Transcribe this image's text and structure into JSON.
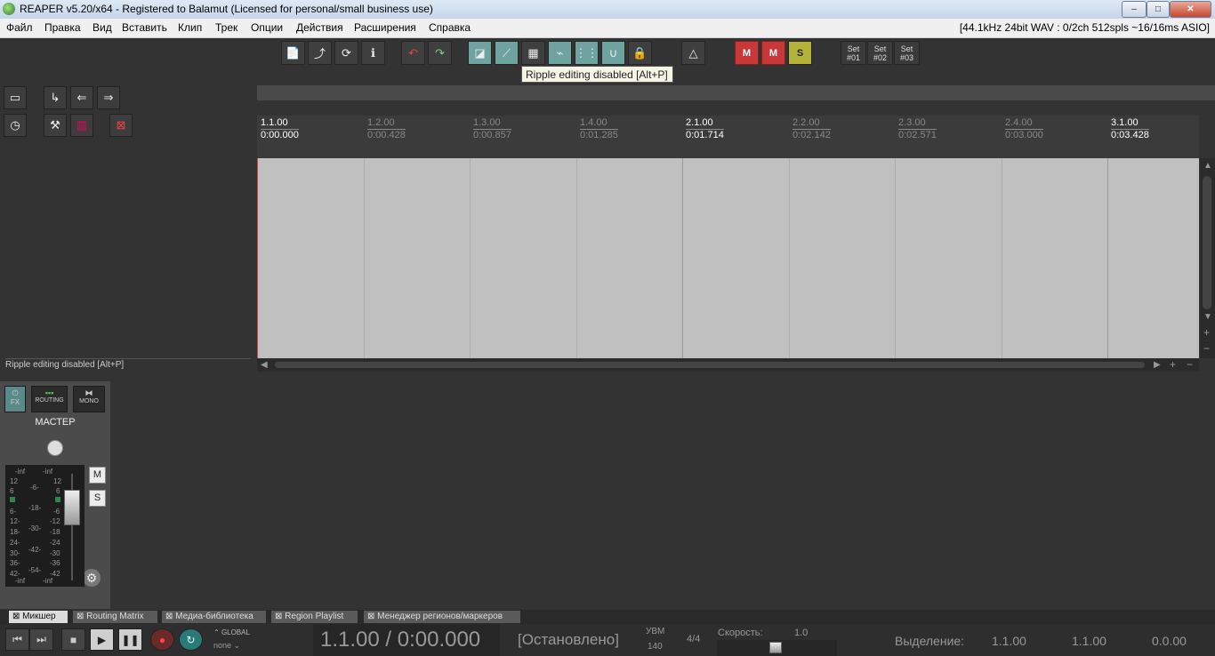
{
  "window": {
    "title": "REAPER v5.20/x64 - Registered to Balamut (Licensed for personal/small business use)",
    "min": "–",
    "max": "□",
    "close": "✕"
  },
  "menu": {
    "items": [
      "Файл",
      "Правка",
      "Вид",
      "Вставить",
      "Клип",
      "Трек",
      "Опции",
      "Действия",
      "Расширения",
      "Справка"
    ],
    "status": "[44.1kHz 24bit WAV : 0/2ch 512spls ~16/16ms ASIO]"
  },
  "toolbar": {
    "set_buttons": [
      {
        "line1": "Set",
        "line2": "#01"
      },
      {
        "line1": "Set",
        "line2": "#02"
      },
      {
        "line1": "Set",
        "line2": "#03"
      }
    ],
    "tooltip": "Ripple editing disabled [Alt+P]",
    "mute_label": "M",
    "solo_label": "S"
  },
  "tcp": {
    "status_text": "Ripple editing disabled [Alt+P]"
  },
  "ruler": {
    "markers": [
      {
        "bar": "1.1.00",
        "time": "0:00.000",
        "major": true
      },
      {
        "bar": "1.2.00",
        "time": "0:00.428",
        "major": false
      },
      {
        "bar": "1.3.00",
        "time": "0:00.857",
        "major": false
      },
      {
        "bar": "1.4.00",
        "time": "0:01.285",
        "major": false
      },
      {
        "bar": "2.1.00",
        "time": "0:01.714",
        "major": true
      },
      {
        "bar": "2.2.00",
        "time": "0:02.142",
        "major": false
      },
      {
        "bar": "2.3.00",
        "time": "0:02.571",
        "major": false
      },
      {
        "bar": "2.4.00",
        "time": "0:03.000",
        "major": false
      },
      {
        "bar": "3.1.00",
        "time": "0:03.428",
        "major": true
      }
    ]
  },
  "mixer": {
    "master_label": "МАСТЕР",
    "fx_label": "FX",
    "routing_label": "ROUTING",
    "mono_label": "MONO",
    "mute": "M",
    "solo": "S",
    "meter_left": [
      "-inf",
      "12",
      "6",
      "-6-",
      "6-",
      "12-",
      "-18-",
      "18-",
      "24-",
      "-30-",
      "30-",
      "36-",
      "-42-",
      "42-",
      "-54-",
      "-inf"
    ],
    "meter_right": [
      "-inf",
      "12",
      "6",
      "-6",
      "-12",
      "-18",
      "-24",
      "-30",
      "-36",
      "-42",
      "-inf"
    ]
  },
  "tabs": [
    "Микшер",
    "Routing Matrix",
    "Медиа-библиотека",
    "Region Playlist",
    "Менеджер регионов/маркеров"
  ],
  "transport": {
    "global_label": "GLOBAL",
    "global_value": "none",
    "position": "1.1.00 / 0:00.000",
    "state": "[Остановлено]",
    "bpm_label": "УВМ",
    "bpm": "140",
    "time_sig": "4/4",
    "rate_label": "Скорость:",
    "rate": "1.0",
    "selection_label": "Выделение:",
    "sel_start": "1.1.00",
    "sel_end": "1.1.00",
    "sel_len": "0.0.00"
  }
}
